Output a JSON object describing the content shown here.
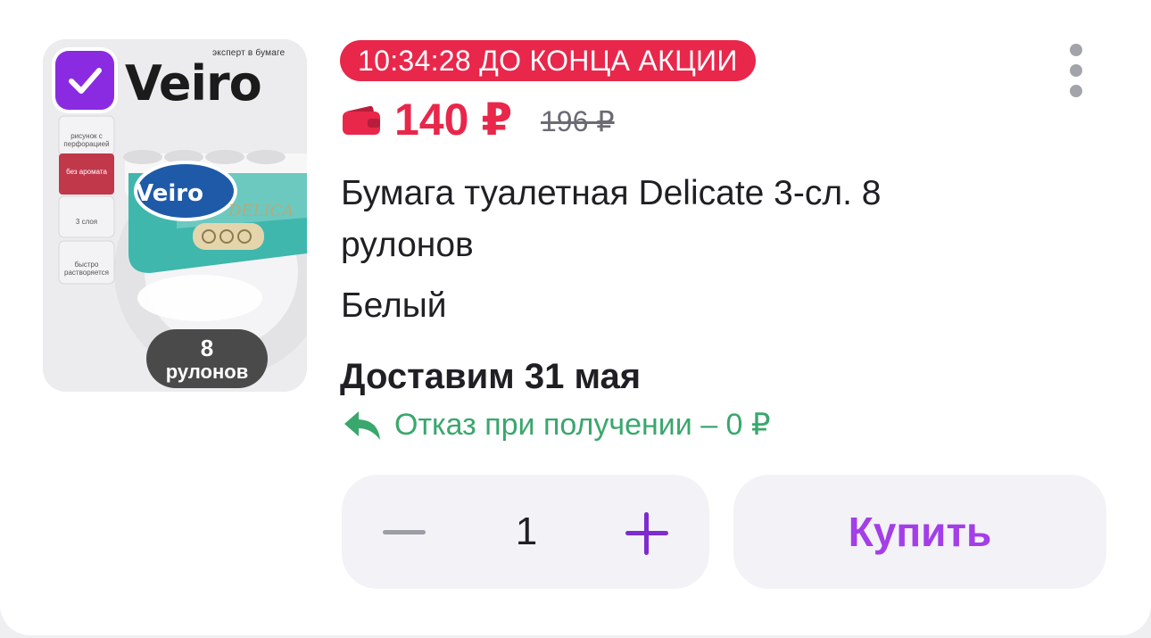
{
  "product": {
    "image": {
      "brand": "Veiro",
      "tagline": "эксперт в бумаге",
      "pack_line": "DELICA",
      "features": [
        "рисунок с перфорацией",
        "без аромата",
        "3 слоя",
        "быстро растворяется"
      ],
      "rolls_badge_number": "8",
      "rolls_badge_word": "рулонов",
      "selected": true
    },
    "timer_badge": "10:34:28 ДО КОНЦА АКЦИИ",
    "price": "140 ₽",
    "old_price": "196 ₽",
    "title": "Бумага туалетная Delicate 3-сл. 8 рулонов",
    "variant": "Белый",
    "delivery": "Доставим 31 мая",
    "refund": "Отказ при получении – 0 ₽"
  },
  "cart": {
    "quantity": "1",
    "buy_label": "Купить"
  },
  "icons": {
    "more": "more-vertical-icon",
    "wallet": "wallet-icon",
    "refund": "return-arrow-icon",
    "check": "check-icon",
    "minus": "minus-icon",
    "plus": "plus-icon"
  },
  "colors": {
    "accent_red": "#e8274b",
    "accent_purple": "#a33ee8",
    "checkbox_purple": "#8a2be2",
    "refund_green": "#3aa76d",
    "control_bg": "#f3f2f6"
  }
}
